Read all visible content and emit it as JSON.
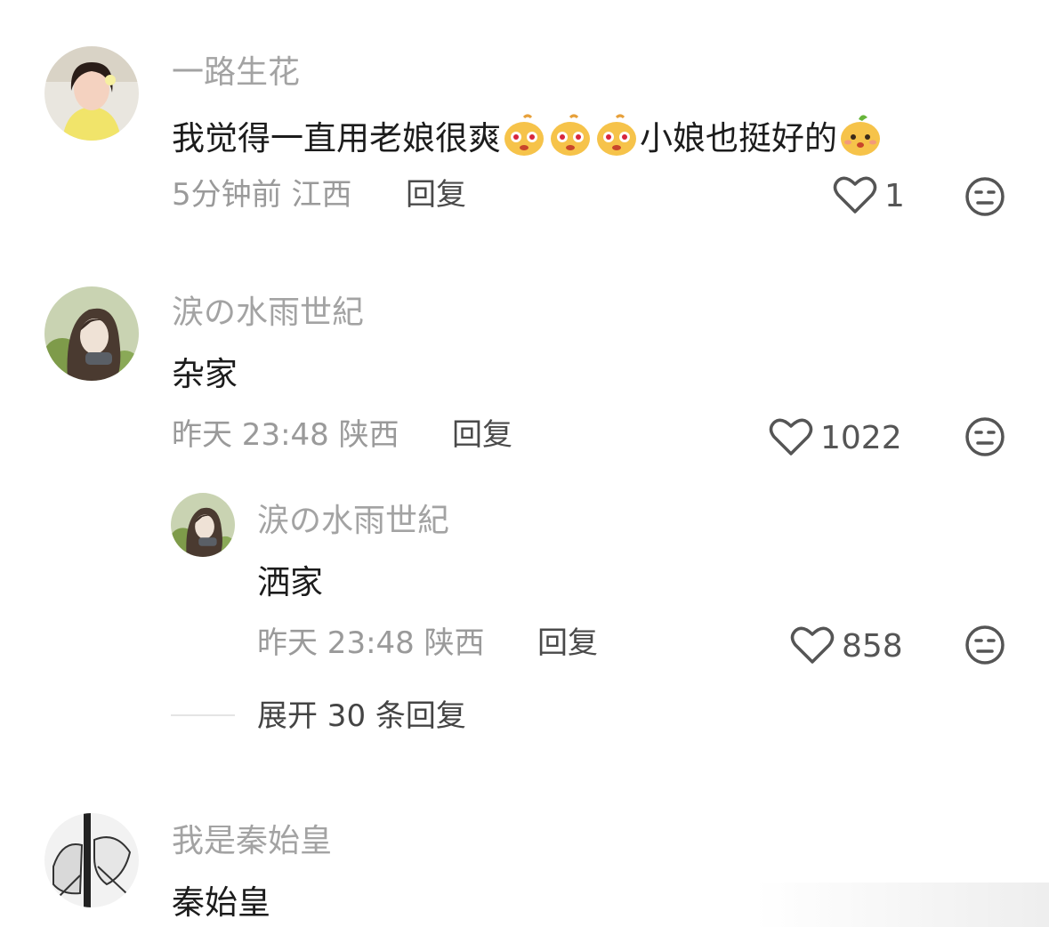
{
  "comments": [
    {
      "username": "一路生花",
      "content_before_emoji": "我觉得一直用老娘很爽",
      "content_after_emoji": "小娘也挺好的",
      "emoji_icon": "bun-face-emoji",
      "time_location": "5分钟前 江西",
      "reply_label": "回复",
      "likes": "1"
    },
    {
      "username": "涙の水雨世紀",
      "content": "杂家",
      "time_location": "昨天 23:48 陕西",
      "reply_label": "回复",
      "likes": "1022",
      "replies": [
        {
          "username": "涙の水雨世紀",
          "content": "洒家",
          "time_location": "昨天 23:48 陕西",
          "reply_label": "回复",
          "likes": "858"
        }
      ],
      "expand_label": "展开 30 条回复"
    },
    {
      "username": "我是秦始皇",
      "content": "秦始皇"
    }
  ],
  "colors": {
    "username": "#a3a3a3",
    "meta": "#9a9a9a",
    "text": "#1c1c1c"
  }
}
